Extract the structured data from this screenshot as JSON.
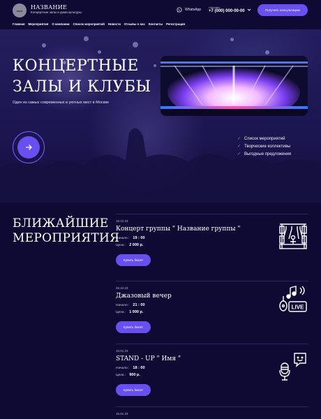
{
  "header": {
    "logo_text": "лого",
    "brand_name": "НАЗВАНИЕ",
    "brand_sub": "Концертные залы и дома культуры",
    "whatsapp_label": "WhatsApp",
    "city": "г.Москва",
    "phone": "+7 (000) 000-00-00",
    "consult_button": "Получить консультацию"
  },
  "nav": [
    "Главная",
    "Мероприятия",
    "О компании",
    "Список мероприятий",
    "Новости",
    "Отзывы о нас",
    "Контакты",
    "Регистрация"
  ],
  "hero": {
    "title_line1": "КОНЦЕРТНЫЕ",
    "title_line2": "ЗАЛЫ И КЛУБЫ",
    "subtitle": "Один из самых современных и уютных мест в Москве",
    "features": [
      "Список мероприятий",
      "Творческие коллективы",
      "Выгодные предложения"
    ]
  },
  "events_section": {
    "title_line1": "БЛИЖАЙШИЕ",
    "title_line2": "МЕРОПРИЯТИЯ",
    "start_label": "Начало :",
    "price_label": "Цена :",
    "buy_label": "Купить билет",
    "events": [
      {
        "date": "18.12.23",
        "name": "Концерт группы \" Название группы \"",
        "start": "19 : 00",
        "price": "2 000 р.",
        "icon": "stage-icon"
      },
      {
        "date": "28.12.23",
        "name": "Джазовый вечер",
        "start": "21 : 00",
        "price": "1 000 р.",
        "icon": "live-music-icon"
      },
      {
        "date": "10.01.23",
        "name": "STAND - UP \" Имя \"",
        "start": "18 : 00",
        "price": "900 р.",
        "icon": "standup-mic-icon"
      }
    ],
    "next_date": "15.01.23"
  },
  "colors": {
    "background": "#0e0a33",
    "accent": "#6a4ff0",
    "check": "#8a78ff"
  }
}
